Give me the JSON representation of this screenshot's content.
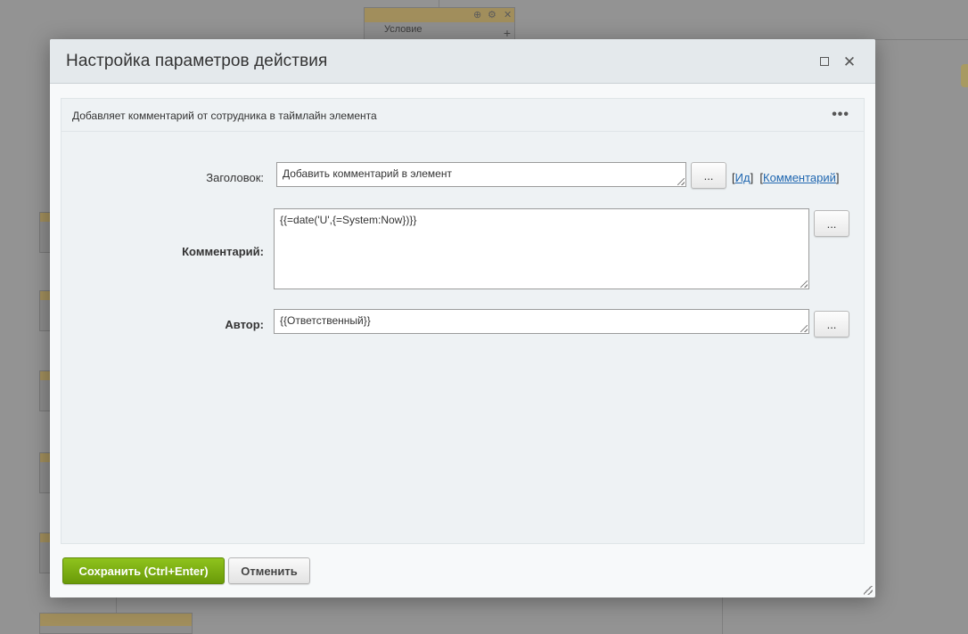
{
  "background": {
    "block_label": "Условие",
    "block_controls": [
      "⊕",
      "⚙",
      "✕"
    ]
  },
  "dialog": {
    "title": "Настройка параметров действия",
    "description": "Добавляет комментарий от сотрудника в таймлайн элемента",
    "fields": {
      "title_label": "Заголовок:",
      "title_value": "Добавить комментарий в элемент",
      "comment_label": "Комментарий:",
      "comment_value": "{{=date('U',{=System:Now})}}",
      "author_label": "Автор:",
      "author_value": "{{Ответственный}}"
    },
    "picker_button": "...",
    "links": {
      "id": "Ид",
      "comment": "Комментарий"
    },
    "buttons": {
      "save": "Сохранить (Ctrl+Enter)",
      "cancel": "Отменить"
    },
    "icons": {
      "maximize": "maximize-icon",
      "close": "close-icon",
      "menu": "more-dots-icon"
    },
    "colors": {
      "save_button": "#7bab12",
      "link": "#2067b0",
      "header": "#e4e9ec"
    }
  }
}
